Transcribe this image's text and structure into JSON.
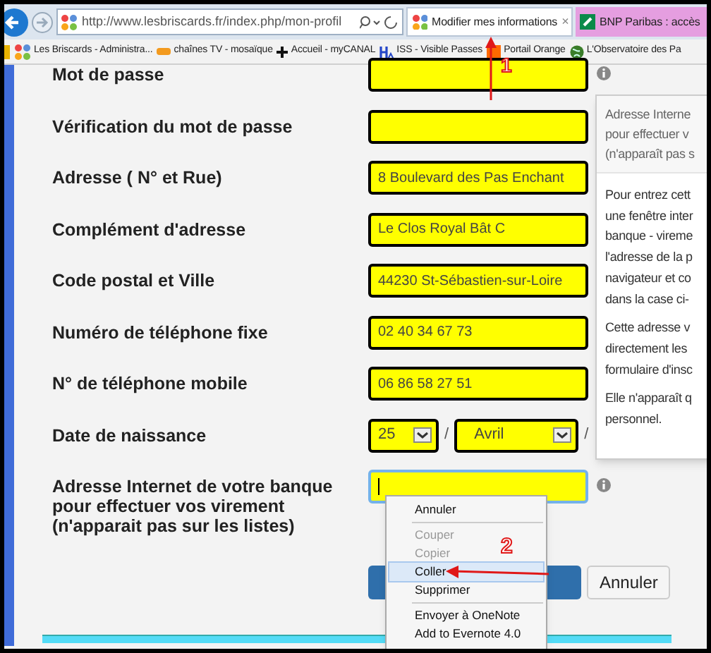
{
  "browser": {
    "url": "http://www.lesbriscards.fr/index.php/mon-profil",
    "tabs": [
      {
        "label": "Modifier mes informations",
        "selected": true,
        "close": "×"
      },
      {
        "label": "BNP Paribas : accès",
        "selected": false
      }
    ],
    "bookmarks": [
      {
        "kind": "joomla",
        "label": "Les Briscards - Administra..."
      },
      {
        "kind": "tv",
        "label": "chaînes TV - mosaïque"
      },
      {
        "kind": "cross",
        "label": "Accueil - myCANAL"
      },
      {
        "kind": "iss",
        "label": "ISS - Visible Passes"
      },
      {
        "kind": "orange",
        "label": "Portail Orange"
      },
      {
        "kind": "globe",
        "label": "L'Observatoire des Pa"
      }
    ]
  },
  "form": {
    "fields": [
      {
        "kind": "text",
        "label": "Mot de passe",
        "focused": false,
        "info": true
      },
      {
        "kind": "text",
        "label": "Vérification du mot de passe",
        "focused": false,
        "info": false
      },
      {
        "kind": "text",
        "label": "Adresse ( N° et Rue)",
        "value": "8 Boulevard des Pas Enchant",
        "focused": false,
        "info": false
      },
      {
        "kind": "text",
        "label": "Complément d'adresse",
        "value": "Le Clos Royal Bât C",
        "focused": false,
        "info": false
      },
      {
        "kind": "text",
        "label": "Code postal et Ville",
        "value": "44230 St-Sébastien-sur-Loire",
        "focused": false,
        "info": false
      },
      {
        "kind": "text",
        "label": "Numéro de téléphone fixe",
        "value": "02 40 34 67 73",
        "focused": false,
        "info": false
      },
      {
        "kind": "text",
        "label": "N° de téléphone mobile",
        "value": "06 86 58 27 51",
        "focused": false,
        "info": false
      },
      {
        "kind": "date",
        "label": "Date de naissance",
        "day": "25",
        "month": "Avril",
        "separators": [
          "/",
          "/"
        ]
      },
      {
        "kind": "text",
        "label": "Adresse Internet de votre banque pour effectuer vos virement (n'apparait pas sur les listes)",
        "focused": true,
        "info": true
      }
    ],
    "buttons": [
      {
        "kind": "primary"
      },
      {
        "kind": "default",
        "label": "Annuler"
      }
    ]
  },
  "tooltip": {
    "title_lines": [
      "Adresse Interne",
      "pour effectuer v",
      "(n'apparaît pas s"
    ],
    "paragraphs": [
      [
        "Pour entrez cett",
        "une fenêtre inter",
        "banque - vireme",
        "l'adresse de la p",
        "navigateur et co",
        "dans la case ci-"
      ],
      [
        "Cette adresse v",
        "directement les",
        "formulaire d'insc"
      ],
      [
        "Elle n'apparaît q",
        "personnel."
      ]
    ]
  },
  "context_menu": [
    {
      "label": "Annuler",
      "disabled": false,
      "selected": false,
      "separator_after": true
    },
    {
      "label": "Couper",
      "disabled": true,
      "selected": false,
      "separator_after": false
    },
    {
      "label": "Copier",
      "disabled": true,
      "selected": false,
      "separator_after": false
    },
    {
      "label": "Coller",
      "disabled": false,
      "selected": true,
      "separator_after": false
    },
    {
      "label": "Supprimer",
      "disabled": false,
      "selected": false,
      "separator_after": true
    },
    {
      "label": "Envoyer à OneNote",
      "disabled": false,
      "selected": false,
      "separator_after": false
    },
    {
      "label": "Add to Evernote 4.0",
      "disabled": false,
      "selected": false,
      "separator_after": false
    }
  ],
  "annotations": [
    {
      "text": "1"
    },
    {
      "text": "2"
    }
  ]
}
